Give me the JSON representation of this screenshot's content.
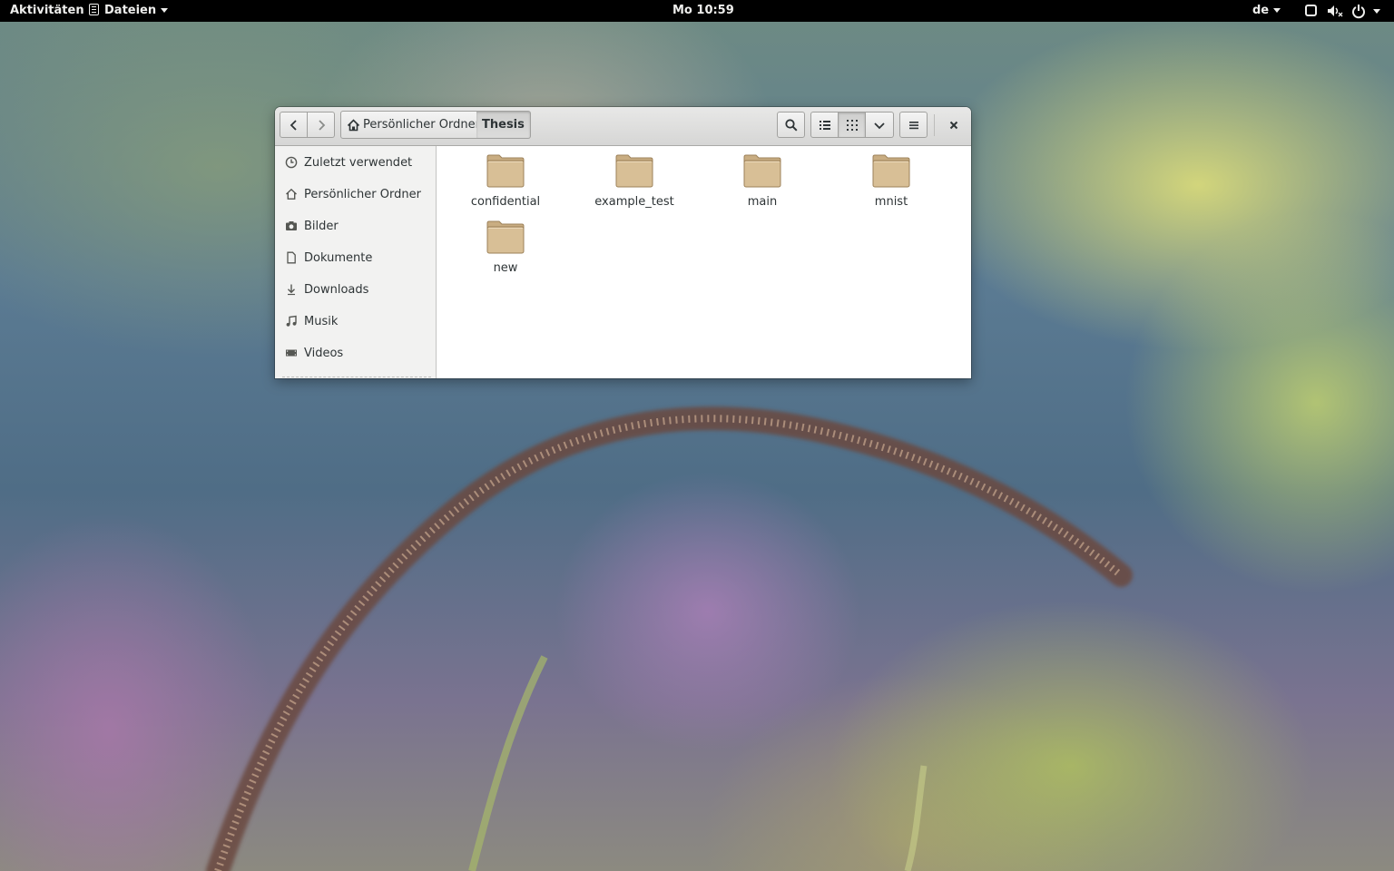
{
  "topbar": {
    "activities": "Aktivitäten",
    "app_menu": "Dateien",
    "clock": "Mo 10:59",
    "keyboard_layout": "de"
  },
  "window": {
    "breadcrumb": {
      "home": "Persönlicher Ordner",
      "current": "Thesis"
    },
    "view_mode": "grid",
    "sidebar": {
      "items": [
        {
          "label": "Zuletzt verwendet",
          "icon": "recent-icon"
        },
        {
          "label": "Persönlicher Ordner",
          "icon": "home-icon"
        },
        {
          "label": "Bilder",
          "icon": "camera-icon"
        },
        {
          "label": "Dokumente",
          "icon": "document-icon"
        },
        {
          "label": "Downloads",
          "icon": "download-icon"
        },
        {
          "label": "Musik",
          "icon": "music-icon"
        },
        {
          "label": "Videos",
          "icon": "video-icon"
        }
      ]
    },
    "folders": [
      {
        "name": "confidential"
      },
      {
        "name": "example_test"
      },
      {
        "name": "main"
      },
      {
        "name": "mnist"
      },
      {
        "name": "new"
      }
    ]
  },
  "colors": {
    "folder_fill": "#d8bf96",
    "folder_tab": "#c9ad82",
    "topbar_bg": "#000000"
  }
}
